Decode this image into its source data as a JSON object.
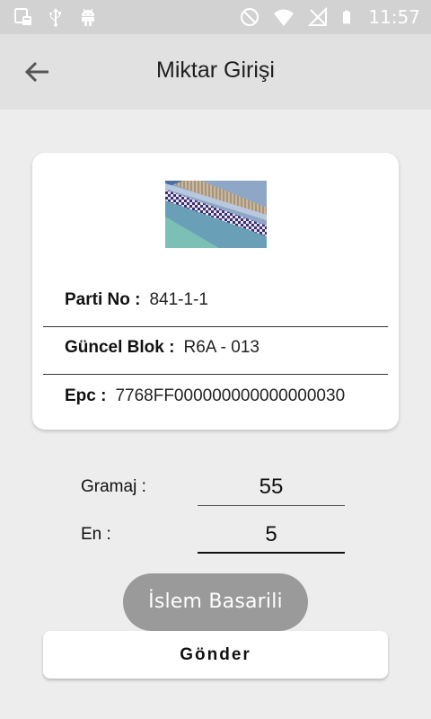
{
  "status_bar": {
    "time": "11:57",
    "icons": [
      "screenshot-icon",
      "usb-icon",
      "android-icon",
      "do-not-disturb-icon",
      "wifi-icon",
      "no-signal-icon",
      "battery-icon"
    ]
  },
  "app_bar": {
    "title": "Miktar Girişi",
    "back_icon": "arrow-left-icon"
  },
  "card": {
    "image": "fabric-image",
    "rows": [
      {
        "label": "Parti No :",
        "value": "841-1-1"
      },
      {
        "label": "Güncel Blok :",
        "value": "R6A - 013"
      },
      {
        "label": "Epc :",
        "value": "7768FF000000000000000030"
      }
    ]
  },
  "form": {
    "gramaj_label": "Gramaj :",
    "gramaj_value": "55",
    "en_label": "En :",
    "en_value": "5"
  },
  "toast": "İslem Basarili",
  "send_button": "Gönder"
}
